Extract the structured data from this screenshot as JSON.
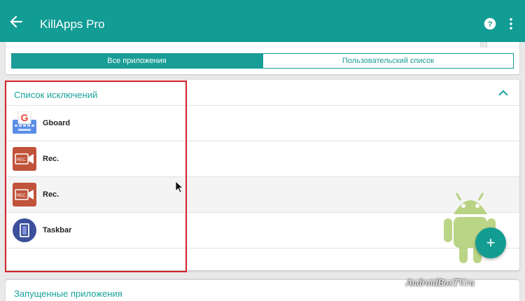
{
  "appbar": {
    "title": "KillApps Pro",
    "back_icon": "arrow-back-icon",
    "help_icon": "help-circle-icon",
    "more_icon": "more-vert-icon"
  },
  "tabs": [
    {
      "label": "Все приложения",
      "active": true
    },
    {
      "label": "Пользовательский список",
      "active": false
    }
  ],
  "exclusion_list": {
    "title": "Список исключений",
    "collapse_icon": "chevron-up-icon",
    "items": [
      {
        "name": "Gboard",
        "icon": "gboard-icon"
      },
      {
        "name": "Rec.",
        "icon": "rec-icon"
      },
      {
        "name": "Rec.",
        "icon": "rec-icon"
      },
      {
        "name": "Taskbar",
        "icon": "taskbar-icon"
      }
    ]
  },
  "running_apps": {
    "title": "Запущенные приложения"
  },
  "fab": {
    "label": "+"
  },
  "watermark": "AndroidBoxTV.ru",
  "colors": {
    "primary": "#119c94",
    "accent": "#19a29a",
    "highlight_box": "#d0222b"
  }
}
